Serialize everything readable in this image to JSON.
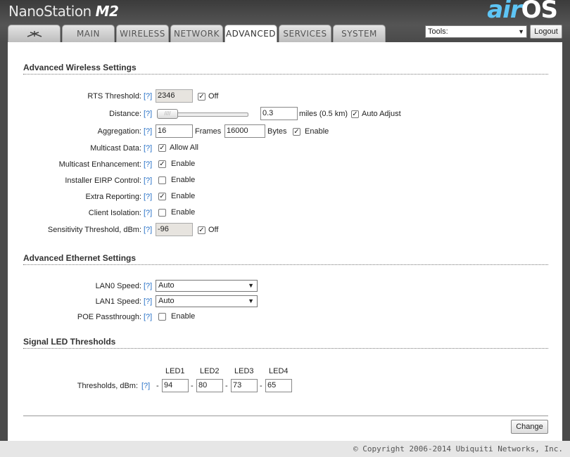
{
  "header": {
    "brand": "NanoStation",
    "brand_model": "M2",
    "logo_air": "air",
    "logo_os": "OS",
    "tabs": [
      {
        "label": "",
        "icon": "ubnt-logo-icon"
      },
      {
        "label": "MAIN"
      },
      {
        "label": "WIRELESS"
      },
      {
        "label": "NETWORK"
      },
      {
        "label": "ADVANCED"
      },
      {
        "label": "SERVICES"
      },
      {
        "label": "SYSTEM"
      }
    ],
    "tools_value": "Tools:",
    "logout_label": "Logout"
  },
  "wireless": {
    "title": "Advanced Wireless Settings",
    "help": "[?]",
    "rts_label": "RTS Threshold:",
    "rts_value": "2346",
    "rts_off": "Off",
    "distance_label": "Distance:",
    "distance_value": "0.3",
    "distance_unit": "miles (0.5 km)",
    "auto_adjust": "Auto Adjust",
    "aggregation_label": "Aggregation:",
    "frames_value": "16",
    "frames_label": "Frames",
    "bytes_value": "16000",
    "bytes_label": "Bytes",
    "aggregation_enable": "Enable",
    "multicast_label": "Multicast Data:",
    "multicast_allow": "Allow All",
    "mcast_enh_label": "Multicast Enhancement:",
    "enable": "Enable",
    "eirp_label": "Installer EIRP Control:",
    "extra_label": "Extra Reporting:",
    "isolation_label": "Client Isolation:",
    "sensitivity_label": "Sensitivity Threshold, dBm:",
    "sensitivity_value": "-96",
    "sensitivity_off": "Off"
  },
  "ethernet": {
    "title": "Advanced Ethernet Settings",
    "lan0_label": "LAN0 Speed:",
    "lan0_value": "Auto",
    "lan1_label": "LAN1 Speed:",
    "lan1_value": "Auto",
    "poe_label": "POE Passthrough:"
  },
  "led": {
    "title": "Signal LED Thresholds",
    "headers": [
      "LED1",
      "LED2",
      "LED3",
      "LED4"
    ],
    "label": "Thresholds, dBm:",
    "dash": "-",
    "values": [
      "94",
      "80",
      "73",
      "65"
    ]
  },
  "actions": {
    "change_label": "Change"
  },
  "footer": {
    "copyright": "© Copyright 2006-2014 Ubiquiti Networks, Inc."
  },
  "colors": {
    "accent": "#5ec5f5",
    "help_link": "#2a73c8",
    "header_bg": "#4a4a4a"
  }
}
